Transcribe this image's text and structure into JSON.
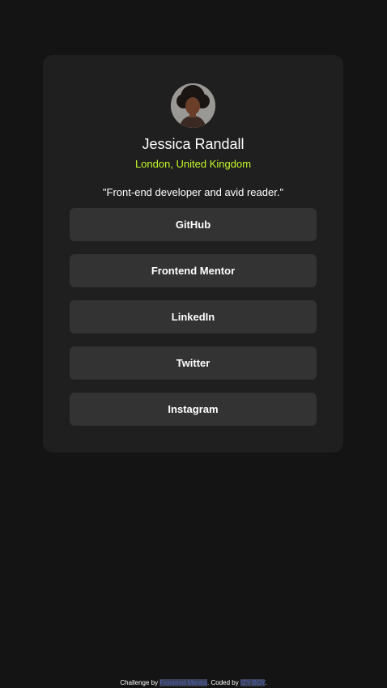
{
  "profile": {
    "name": "Jessica Randall",
    "location": "London, United Kingdom",
    "bio": "\"Front-end developer and avid reader.\""
  },
  "links": [
    {
      "label": "GitHub"
    },
    {
      "label": "Frontend Mentor"
    },
    {
      "label": "LinkedIn"
    },
    {
      "label": "Twitter"
    },
    {
      "label": "Instagram"
    }
  ],
  "footer": {
    "prefix": "Challenge by ",
    "challenge_link": "Frontend Mentor",
    "middle": ". Coded by ",
    "author_link": "IZY BOY",
    "suffix": "."
  },
  "colors": {
    "page_bg": "#141414",
    "card_bg": "#1f1f1f",
    "button_bg": "#333333",
    "accent_green": "#c4f82a"
  },
  "icons": {
    "avatar": "profile-photo"
  }
}
